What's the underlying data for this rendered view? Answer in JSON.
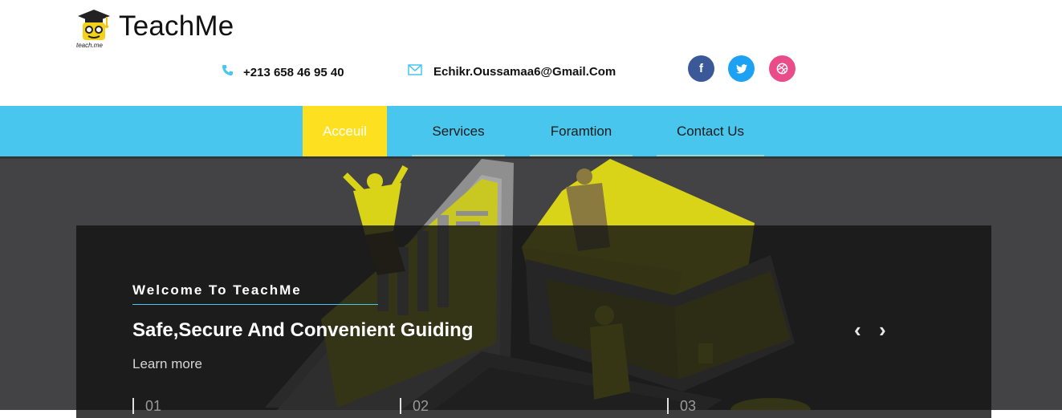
{
  "brand": {
    "name": "TeachMe",
    "caption": "teach.me"
  },
  "contact": {
    "phone": "+213 658 46 95 40",
    "email": "Echikr.Oussamaa6@Gmail.Com"
  },
  "social": {
    "facebook": "f",
    "twitter": "t",
    "dribbble": "d"
  },
  "nav": {
    "items": [
      {
        "label": "Acceuil",
        "active": true
      },
      {
        "label": "Services"
      },
      {
        "label": "Foramtion"
      },
      {
        "label": "Contact Us"
      }
    ]
  },
  "hero": {
    "welcome": "Welcome To TeachMe",
    "headline": "Safe,Secure And Convenient Guiding",
    "learn_more": "Learn more",
    "steps": [
      "01",
      "02",
      "03"
    ],
    "prev": "‹",
    "next": "›"
  },
  "colors": {
    "accent": "#48c6ee",
    "active": "#fde020",
    "illustration": "#d9d418"
  }
}
